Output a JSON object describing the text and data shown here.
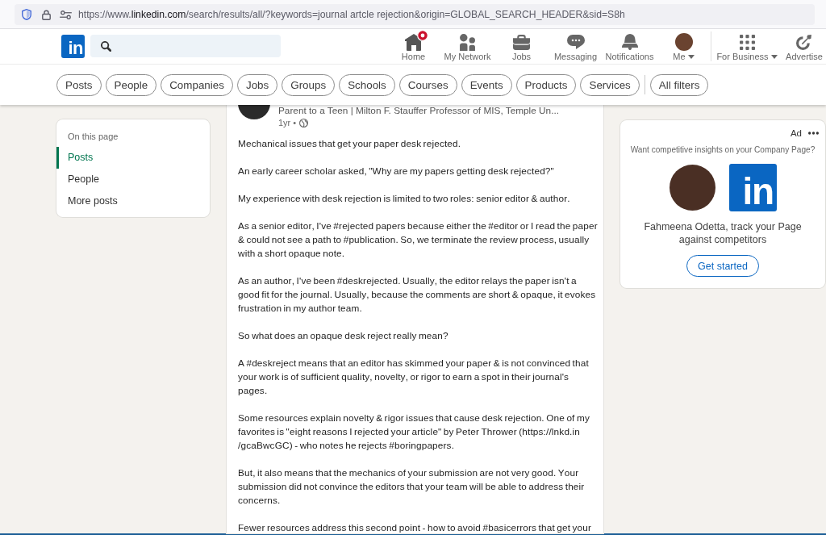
{
  "browser": {
    "url": "https://www.linkedin.com/search/results/all/?keywords=journal artcle rejection&origin=GLOBAL_SEARCH_HEADER&sid=S8h"
  },
  "header": {
    "logo": "in",
    "nav": [
      {
        "kind": "home",
        "label": "Home",
        "badge": true,
        "dropdown": false
      },
      {
        "kind": "network",
        "label": "My Network",
        "badge": false,
        "dropdown": false
      },
      {
        "kind": "jobs",
        "label": "Jobs",
        "badge": false,
        "dropdown": false
      },
      {
        "kind": "messaging",
        "label": "Messaging",
        "badge": false,
        "dropdown": false
      },
      {
        "kind": "notifications",
        "label": "Notifications",
        "badge": false,
        "dropdown": false
      },
      {
        "kind": "me",
        "label": "Me",
        "badge": false,
        "dropdown": true
      }
    ],
    "business_nav": [
      {
        "kind": "business",
        "label": "For Business",
        "badge": false,
        "dropdown": true
      },
      {
        "kind": "advertise",
        "label": "Advertise",
        "badge": false,
        "dropdown": false
      }
    ]
  },
  "filters": {
    "pills": [
      "Posts",
      "People",
      "Companies",
      "Jobs",
      "Groups",
      "Schools",
      "Courses",
      "Events",
      "Products",
      "Services"
    ],
    "all_filters": "All filters"
  },
  "sidebar": {
    "heading": "On this page",
    "items": [
      {
        "label": "Posts",
        "selected": true
      },
      {
        "label": "People",
        "selected": false
      },
      {
        "label": "More posts",
        "selected": false
      }
    ]
  },
  "post": {
    "author_headline": "Parent to a Teen | Milton F. Stauffer Professor of MIS, Temple Un...",
    "age": "1yr •",
    "paragraphs": [
      "Mechanical issues that get your paper desk rejected.",
      "An early career scholar asked, \"Why are my papers getting desk rejected?\"",
      "My experience with desk rejection is limited to two roles: senior editor & author.",
      "As a senior editor, I've #rejected papers because either the #editor or I read the paper & could not see a path to #publication. So, we terminate the review process, usually with a short opaque note.",
      "As an author, I've been #deskrejected. Usually, the editor relays the paper isn't a good fit for the journal. Usually, because the comments are short & opaque, it evokes frustration in my author team.",
      "So what does an opaque desk reject really mean?",
      "A #deskreject means that an editor has skimmed your paper & is not convinced that your work is of sufficient quality, novelty, or rigor to earn a spot in their journal's pages.",
      "Some resources explain novelty & rigor issues that cause desk rejection. One of my favorites is \"eight reasons I rejected your article\" by Peter Thrower (https://lnkd.in /gcaBwcGC) - who notes he rejects #boringpapers.",
      "But, it also means that the mechanics of your submission are not very good. Your submission did not convince the editors that your team will be able to address their concerns.",
      "Fewer resources address this second point - how to avoid #basicerrors that get your"
    ]
  },
  "ad": {
    "label": "Ad",
    "prompt": "Want competitive insights on your Company Page?",
    "logo": "in",
    "message": "Fahmeena Odetta, track your Page against competitors",
    "button": "Get started"
  }
}
